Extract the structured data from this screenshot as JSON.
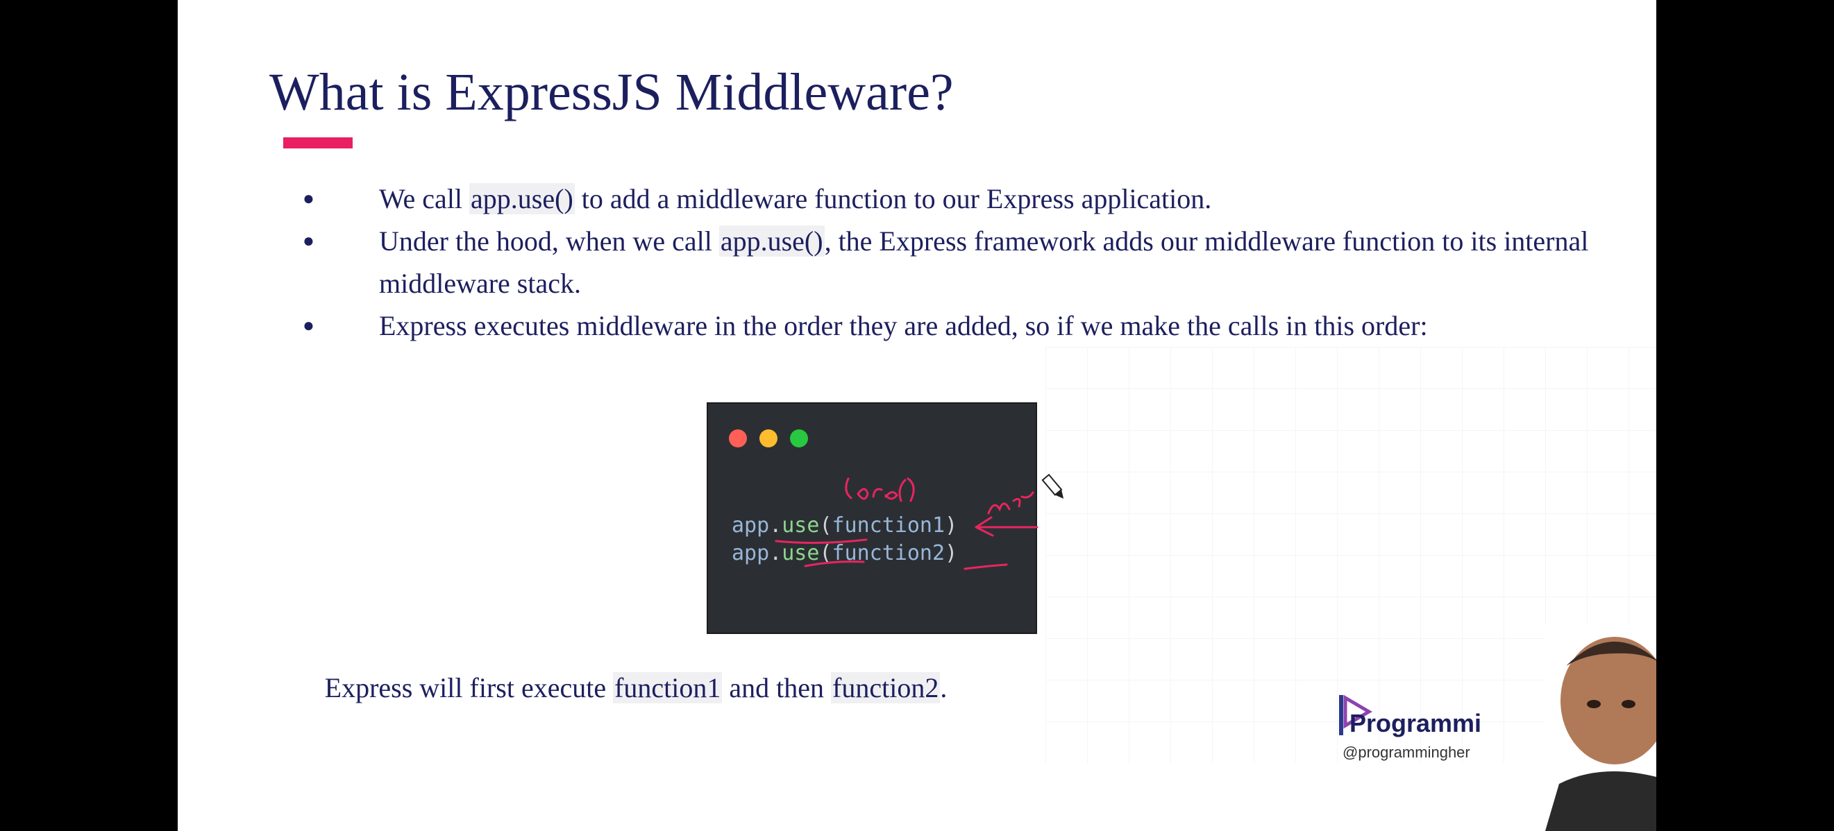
{
  "slide": {
    "title": "What is ExpressJS Middleware?",
    "accent_color": "#e91e63",
    "bullets": [
      {
        "pre": "We call ",
        "code": "app.use()",
        "post": " to add a middleware function to our Express application."
      },
      {
        "pre": "Under the hood, when we call ",
        "code": "app.use()",
        "post": ", the Express framework adds our middleware function to its internal middleware stack."
      },
      {
        "pre": "Express executes middleware in the order they are added, so if we make the calls in this order:",
        "code": "",
        "post": ""
      }
    ],
    "code_window": {
      "lines": [
        {
          "obj": "app",
          "dot": ".",
          "method": "use",
          "open": "(",
          "arg": "function1",
          "close": ")"
        },
        {
          "obj": "app",
          "dot": ".",
          "method": "use",
          "open": "(",
          "arg": "function2",
          "close": ")"
        }
      ],
      "annotation_ink_color": "#e8255f"
    },
    "caption": {
      "pre": "Express will first execute ",
      "code1": "function1",
      "mid": " and then ",
      "code2": "function2",
      "post": "."
    },
    "brand": {
      "logo_text": "Programmi",
      "handle": "@programmingher"
    }
  }
}
